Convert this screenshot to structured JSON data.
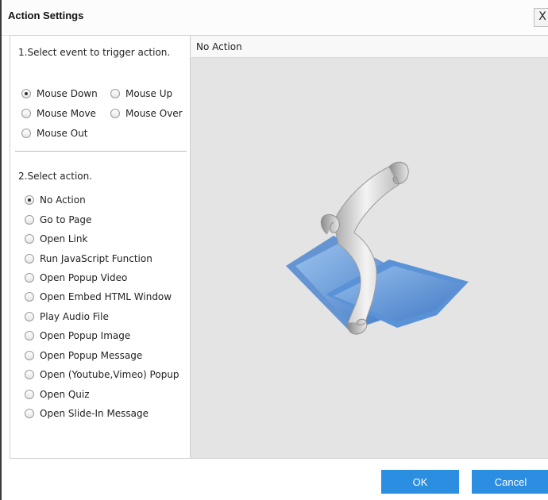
{
  "window": {
    "title": "Action Settings",
    "close_label": "X"
  },
  "event_section": {
    "label": "1.Select event to trigger action.",
    "options": [
      {
        "label": "Mouse Down",
        "checked": true
      },
      {
        "label": "Mouse Up",
        "checked": false
      },
      {
        "label": "Mouse Move",
        "checked": false
      },
      {
        "label": "Mouse Over",
        "checked": false
      },
      {
        "label": "Mouse Out",
        "checked": false
      }
    ]
  },
  "action_section": {
    "label": "2.Select action.",
    "options": [
      {
        "label": "No Action",
        "checked": true
      },
      {
        "label": "Go to Page",
        "checked": false
      },
      {
        "label": "Open Link",
        "checked": false
      },
      {
        "label": "Run JavaScript Function",
        "checked": false
      },
      {
        "label": "Open Popup Video",
        "checked": false
      },
      {
        "label": "Open Embed HTML Window",
        "checked": false
      },
      {
        "label": "Play Audio File",
        "checked": false
      },
      {
        "label": "Open Popup Image",
        "checked": false
      },
      {
        "label": "Open Popup Message",
        "checked": false
      },
      {
        "label": "Open (Youtube,Vimeo) Popup",
        "checked": false
      },
      {
        "label": "Open Quiz",
        "checked": false
      },
      {
        "label": "Open Slide-In Message",
        "checked": false
      }
    ]
  },
  "preview": {
    "title": "No Action",
    "icon": "scroll-on-folder-icon"
  },
  "buttons": {
    "ok": "OK",
    "cancel": "Cancel"
  },
  "colors": {
    "button": "#2c8ee0",
    "preview_bg": "#e4e4e4",
    "folder": "#6e9fdc",
    "scroll": "#d9d9d9"
  }
}
